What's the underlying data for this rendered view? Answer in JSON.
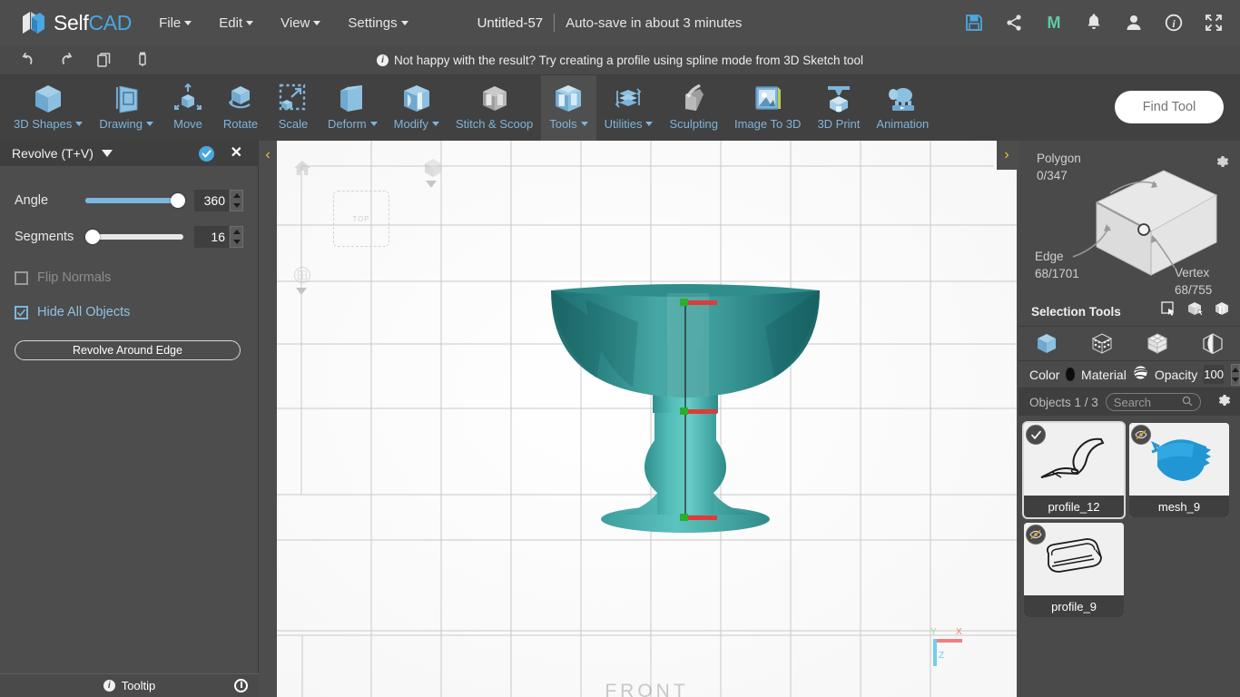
{
  "app": {
    "brand_self": "Self",
    "brand_cad": "CAD",
    "accent_blue": "#4aa7e0",
    "model_color": "#3fa3a0"
  },
  "menu": {
    "items": [
      {
        "label": "File",
        "caret": true
      },
      {
        "label": "Edit",
        "caret": true
      },
      {
        "label": "View",
        "caret": true
      },
      {
        "label": "Settings",
        "caret": true
      }
    ]
  },
  "document": {
    "title": "Untitled-57",
    "autosave": "Auto-save in about 3 minutes"
  },
  "top_icons": [
    {
      "name": "save-icon",
      "title": "Save"
    },
    {
      "name": "share-icon",
      "title": "Share"
    },
    {
      "name": "m-logo-icon",
      "title": "M"
    },
    {
      "name": "notifications-bell-icon",
      "title": "Notifications"
    },
    {
      "name": "user-account-icon",
      "title": "Account"
    },
    {
      "name": "info-icon",
      "title": "Info"
    },
    {
      "name": "fullscreen-icon",
      "title": "Fullscreen"
    }
  ],
  "subbar": {
    "icons": [
      {
        "name": "undo-icon"
      },
      {
        "name": "redo-icon"
      },
      {
        "name": "copy-icon"
      },
      {
        "name": "delete-icon"
      }
    ],
    "notice": "Not happy with the result? Try creating a profile using spline mode from 3D Sketch tool"
  },
  "toolbar": {
    "tools": [
      {
        "label": "3D Shapes",
        "icon": "cube-icon",
        "caret": true,
        "active": false
      },
      {
        "label": "Drawing",
        "icon": "drawing-icon",
        "caret": true,
        "active": false
      },
      {
        "label": "Move",
        "icon": "move-icon",
        "caret": false,
        "active": false
      },
      {
        "label": "Rotate",
        "icon": "rotate-icon",
        "caret": false,
        "active": false
      },
      {
        "label": "Scale",
        "icon": "scale-icon",
        "caret": false,
        "active": false
      },
      {
        "label": "Deform",
        "icon": "deform-icon",
        "caret": true,
        "active": false
      },
      {
        "label": "Modify",
        "icon": "modify-icon",
        "caret": true,
        "active": false
      },
      {
        "label": "Stitch & Scoop",
        "icon": "stitch-scoop-icon",
        "caret": false,
        "active": false
      },
      {
        "label": "Tools",
        "icon": "tools-icon",
        "caret": true,
        "active": true
      },
      {
        "label": "Utilities",
        "icon": "utilities-icon",
        "caret": true,
        "active": false
      },
      {
        "label": "Sculpting",
        "icon": "sculpting-icon",
        "caret": false,
        "active": false
      },
      {
        "label": "Image To 3D",
        "icon": "image-to-3d-icon",
        "caret": false,
        "active": false
      },
      {
        "label": "3D Print",
        "icon": "3d-print-icon",
        "caret": false,
        "active": false
      },
      {
        "label": "Animation",
        "icon": "animation-icon",
        "caret": false,
        "active": false
      }
    ],
    "find_tool_placeholder": "Find Tool"
  },
  "left_panel": {
    "title": "Revolve (T+V)",
    "angle": {
      "label": "Angle",
      "value": "360",
      "percent": 100
    },
    "segments": {
      "label": "Segments",
      "value": "16",
      "percent": 2
    },
    "flip_normals": {
      "label": "Flip Normals",
      "checked": false,
      "disabled": true
    },
    "hide_all_objects": {
      "label": "Hide All Objects",
      "checked": true,
      "disabled": false
    },
    "revolve_button": "Revolve Around Edge",
    "tooltip_label": "Tooltip"
  },
  "viewport": {
    "view_label": "FRONT",
    "top_face_label": "TOP",
    "axes": {
      "x": "X",
      "y": "Y",
      "z": "Z",
      "x_color": "#f08080",
      "y_color": "#8ee08e",
      "z_color": "#6fd0f0"
    }
  },
  "right_panel": {
    "selection": {
      "polygon_label": "Polygon",
      "polygon_value": "0/347",
      "edge_label": "Edge",
      "edge_value": "68/1701",
      "vertex_label": "Vertex",
      "vertex_value": "68/755",
      "selection_tools_label": "Selection Tools"
    },
    "modes": [
      {
        "name": "object-mode-icon"
      },
      {
        "name": "vertex-mode-icon"
      },
      {
        "name": "polygon-mode-icon"
      },
      {
        "name": "edge-mode-icon"
      }
    ],
    "color_label": "Color",
    "color_value": "#0d0d0d",
    "material_label": "Material",
    "opacity_label": "Opacity",
    "opacity_value": "100",
    "objects_count": "Objects 1 / 3",
    "search_placeholder": "Search",
    "objects": [
      {
        "name": "profile_12",
        "thumb": "spline-profile",
        "visible": true,
        "selected": true
      },
      {
        "name": "mesh_9",
        "thumb": "blue-mesh",
        "visible": false,
        "selected": false
      },
      {
        "name": "profile_9",
        "thumb": "flat-profile",
        "visible": false,
        "selected": false
      }
    ]
  }
}
